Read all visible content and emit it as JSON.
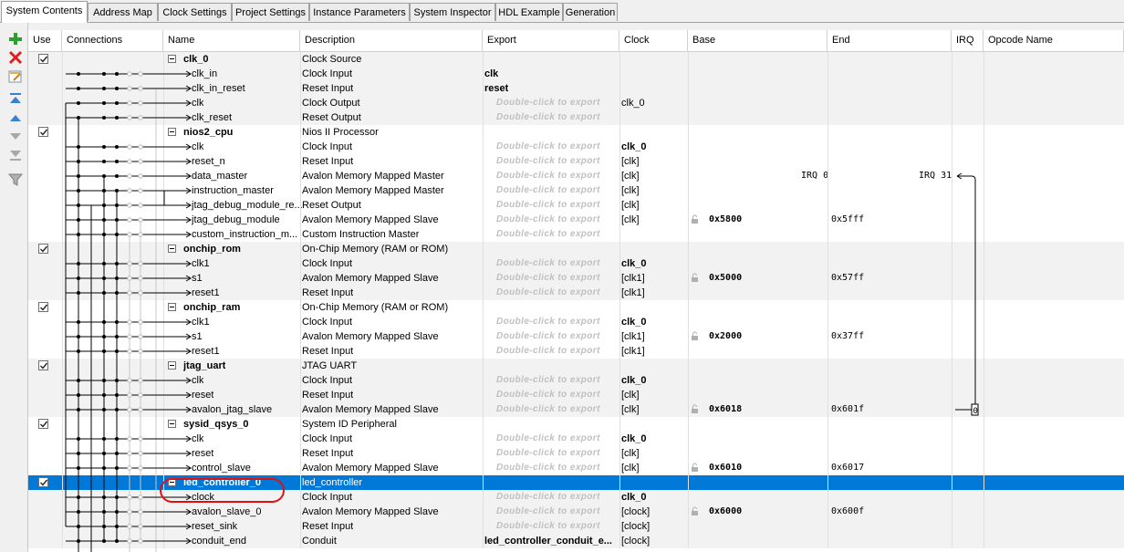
{
  "tabs": [
    {
      "label": "System Contents",
      "active": true
    },
    {
      "label": "Address Map"
    },
    {
      "label": "Clock Settings"
    },
    {
      "label": "Project Settings"
    },
    {
      "label": "Instance Parameters"
    },
    {
      "label": "System Inspector"
    },
    {
      "label": "HDL Example"
    },
    {
      "label": "Generation"
    }
  ],
  "toolbar": [
    "add-icon",
    "remove-icon",
    "edit-icon",
    "move-top-icon",
    "move-up-icon",
    "move-down-icon",
    "move-bottom-icon",
    "filter-icon"
  ],
  "columns": [
    "Use",
    "Connections",
    "Name",
    "Description",
    "Export",
    "Clock",
    "Base",
    "End",
    "IRQ",
    "Opcode Name"
  ],
  "colors": {
    "selection": "#0078d7",
    "alt_row": "#f2f2f2",
    "export_placeholder": "#c0c0c0",
    "highlight_ring": "#e01010"
  },
  "rows": [
    {
      "type": "component",
      "name": "clk_0",
      "desc": "Clock Source",
      "checked": true
    },
    {
      "type": "port",
      "name": "clk_in",
      "desc": "Clock Input",
      "export": "clk",
      "export_bold": true
    },
    {
      "type": "port",
      "name": "clk_in_reset",
      "desc": "Reset Input",
      "export": "reset",
      "export_bold": true
    },
    {
      "type": "port",
      "name": "clk",
      "desc": "Clock Output",
      "export": "Double-click to export",
      "clock": "clk_0"
    },
    {
      "type": "port",
      "name": "clk_reset",
      "desc": "Reset Output",
      "export": "Double-click to export"
    },
    {
      "type": "component",
      "name": "nios2_cpu",
      "desc": "Nios II Processor",
      "checked": true
    },
    {
      "type": "port",
      "name": "clk",
      "desc": "Clock Input",
      "export": "Double-click to export",
      "clock": "clk_0",
      "clock_bold": true
    },
    {
      "type": "port",
      "name": "reset_n",
      "desc": "Reset Input",
      "export": "Double-click to export",
      "clock": "[clk]"
    },
    {
      "type": "port",
      "name": "data_master",
      "desc": "Avalon Memory Mapped Master",
      "export": "Double-click to export",
      "clock": "[clk]",
      "end": "IRQ 0",
      "irq": "IRQ 31"
    },
    {
      "type": "port",
      "name": "instruction_master",
      "desc": "Avalon Memory Mapped Master",
      "export": "Double-click to export",
      "clock": "[clk]"
    },
    {
      "type": "port",
      "name": "jtag_debug_module_re...",
      "desc": "Reset Output",
      "export": "Double-click to export",
      "clock": "[clk]"
    },
    {
      "type": "port",
      "name": "jtag_debug_module",
      "desc": "Avalon Memory Mapped Slave",
      "export": "Double-click to export",
      "clock": "[clk]",
      "base": "0x5800",
      "end": "0x5fff"
    },
    {
      "type": "port",
      "name": "custom_instruction_m...",
      "desc": "Custom Instruction Master",
      "export": "Double-click to export"
    },
    {
      "type": "component",
      "name": "onchip_rom",
      "desc": "On-Chip Memory (RAM or ROM)",
      "checked": true
    },
    {
      "type": "port",
      "name": "clk1",
      "desc": "Clock Input",
      "export": "Double-click to export",
      "clock": "clk_0",
      "clock_bold": true
    },
    {
      "type": "port",
      "name": "s1",
      "desc": "Avalon Memory Mapped Slave",
      "export": "Double-click to export",
      "clock": "[clk1]",
      "base": "0x5000",
      "end": "0x57ff"
    },
    {
      "type": "port",
      "name": "reset1",
      "desc": "Reset Input",
      "export": "Double-click to export",
      "clock": "[clk1]"
    },
    {
      "type": "component",
      "name": "onchip_ram",
      "desc": "On-Chip Memory (RAM or ROM)",
      "checked": true
    },
    {
      "type": "port",
      "name": "clk1",
      "desc": "Clock Input",
      "export": "Double-click to export",
      "clock": "clk_0",
      "clock_bold": true
    },
    {
      "type": "port",
      "name": "s1",
      "desc": "Avalon Memory Mapped Slave",
      "export": "Double-click to export",
      "clock": "[clk1]",
      "base": "0x2000",
      "end": "0x37ff"
    },
    {
      "type": "port",
      "name": "reset1",
      "desc": "Reset Input",
      "export": "Double-click to export",
      "clock": "[clk1]"
    },
    {
      "type": "component",
      "name": "jtag_uart",
      "desc": "JTAG UART",
      "checked": true
    },
    {
      "type": "port",
      "name": "clk",
      "desc": "Clock Input",
      "export": "Double-click to export",
      "clock": "clk_0",
      "clock_bold": true
    },
    {
      "type": "port",
      "name": "reset",
      "desc": "Reset Input",
      "export": "Double-click to export",
      "clock": "[clk]"
    },
    {
      "type": "port",
      "name": "avalon_jtag_slave",
      "desc": "Avalon Memory Mapped Slave",
      "export": "Double-click to export",
      "clock": "[clk]",
      "base": "0x6018",
      "end": "0x601f",
      "irq": "0"
    },
    {
      "type": "component",
      "name": "sysid_qsys_0",
      "desc": "System ID Peripheral",
      "checked": true
    },
    {
      "type": "port",
      "name": "clk",
      "desc": "Clock Input",
      "export": "Double-click to export",
      "clock": "clk_0",
      "clock_bold": true
    },
    {
      "type": "port",
      "name": "reset",
      "desc": "Reset Input",
      "export": "Double-click to export",
      "clock": "[clk]"
    },
    {
      "type": "port",
      "name": "control_slave",
      "desc": "Avalon Memory Mapped Slave",
      "export": "Double-click to export",
      "clock": "[clk]",
      "base": "0x6010",
      "end": "0x6017"
    },
    {
      "type": "component",
      "name": "led_controller_0",
      "desc": "led_controller",
      "checked": true,
      "selected": true
    },
    {
      "type": "port",
      "name": "clock",
      "desc": "Clock Input",
      "export": "Double-click to export",
      "clock": "clk_0",
      "clock_bold": true
    },
    {
      "type": "port",
      "name": "avalon_slave_0",
      "desc": "Avalon Memory Mapped Slave",
      "export": "Double-click to export",
      "clock": "[clock]",
      "base": "0x6000",
      "end": "0x600f"
    },
    {
      "type": "port",
      "name": "reset_sink",
      "desc": "Reset Input",
      "export": "Double-click to export",
      "clock": "[clock]"
    },
    {
      "type": "port",
      "name": "conduit_end",
      "desc": "Conduit",
      "export": "led_controller_conduit_e...",
      "export_bold": true,
      "clock": "[clock]"
    }
  ]
}
